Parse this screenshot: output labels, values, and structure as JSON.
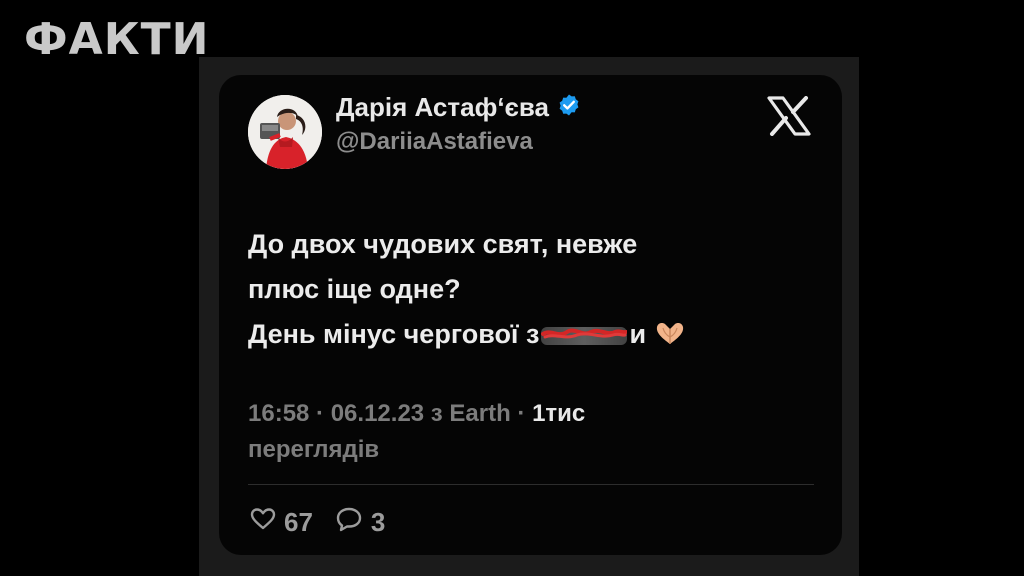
{
  "brand": {
    "label": "ФАКТИ"
  },
  "tweet": {
    "author_name": "Дарія Астаф‘єва",
    "author_handle": "@DariiaAstafieva",
    "verified": true,
    "text_line1": "До двох чудових свят, невже",
    "text_line2": "плюс іще одне?",
    "text_line3_prefix": "День мінус чергової з",
    "text_line3_suffix": "и",
    "emoji": "heart-hands-emoji",
    "meta_line1": "16:58 · 06.12.23 з Earth · ",
    "views_count": "1тис",
    "meta_line2": "переглядів",
    "likes": "67",
    "replies": "3"
  },
  "colors": {
    "background": "#000000",
    "frame": "#1b1b1b",
    "card": "#050505",
    "verified_badge": "#1d9bf0",
    "text_primary": "#ececec",
    "text_secondary": "#7c7c7c"
  },
  "icons": {
    "platform": "x-logo-icon",
    "like": "heart-icon",
    "reply": "reply-bubble-icon"
  }
}
